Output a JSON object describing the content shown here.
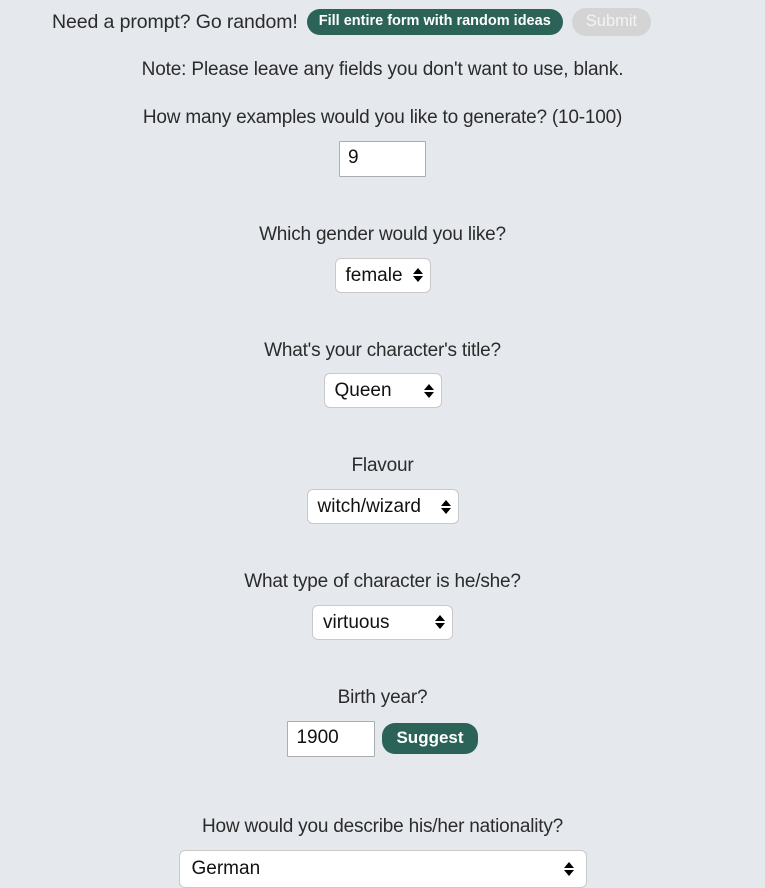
{
  "random_prompt": {
    "label": "Need a prompt? Go random!",
    "fill_button": "Fill entire form with random ideas",
    "submit_button": "Submit"
  },
  "note": "Note: Please leave any fields you don't want to use, blank.",
  "fields": {
    "count": {
      "label": "How many examples would you like to generate? (10-100)",
      "value": "9"
    },
    "gender": {
      "label": "Which gender would you like?",
      "value": "female"
    },
    "title": {
      "label": "What's your character's title?",
      "value": "Queen"
    },
    "flavour": {
      "label": "Flavour",
      "value": "witch/wizard"
    },
    "character_type": {
      "label": "What type of character is he/she?",
      "value": "virtuous"
    },
    "birth_year": {
      "label": "Birth year?",
      "value": "1900",
      "suggest_button": "Suggest"
    },
    "nationality": {
      "label": "How would you describe his/her nationality?",
      "value": "German"
    }
  },
  "colors": {
    "background": "#e5e8ed",
    "accent_teal": "#2b6359",
    "disabled_gray": "#d4d4d4",
    "input_white": "#ffffff",
    "text": "#2b2b2b"
  }
}
